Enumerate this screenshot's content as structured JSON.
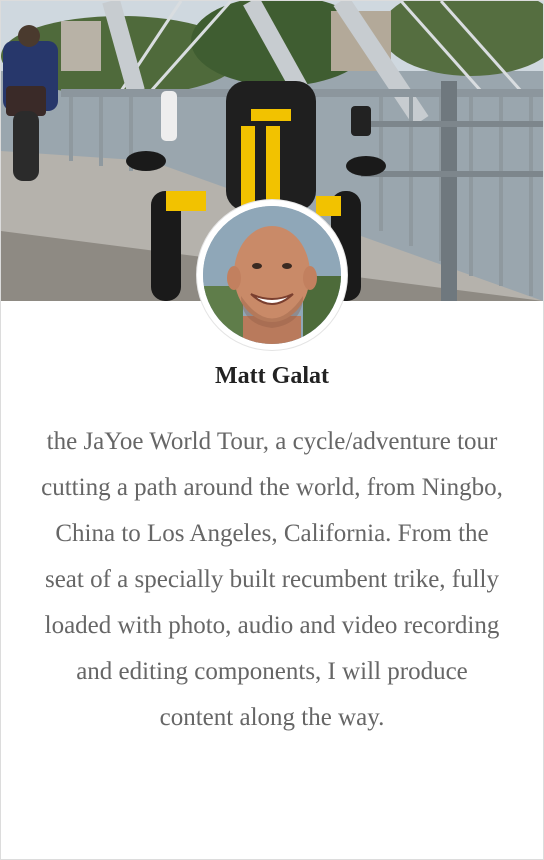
{
  "profile": {
    "name": "Matt Galat",
    "bio": "the JaYoe World Tour, a cycle/adventure tour cutting a path around the world, from Ningbo, China to Los Angeles, California. From the seat of a specially built recumbent trike, fully loaded with photo, audio and video recording and editing components, I will produce content along the way."
  },
  "cover": {
    "description_icon": "recumbent-trike-on-bridge-photo",
    "seat_logo": "JaYoe"
  },
  "colors": {
    "name_text": "#222222",
    "bio_text": "#666666",
    "trike_yellow": "#f2c200"
  }
}
